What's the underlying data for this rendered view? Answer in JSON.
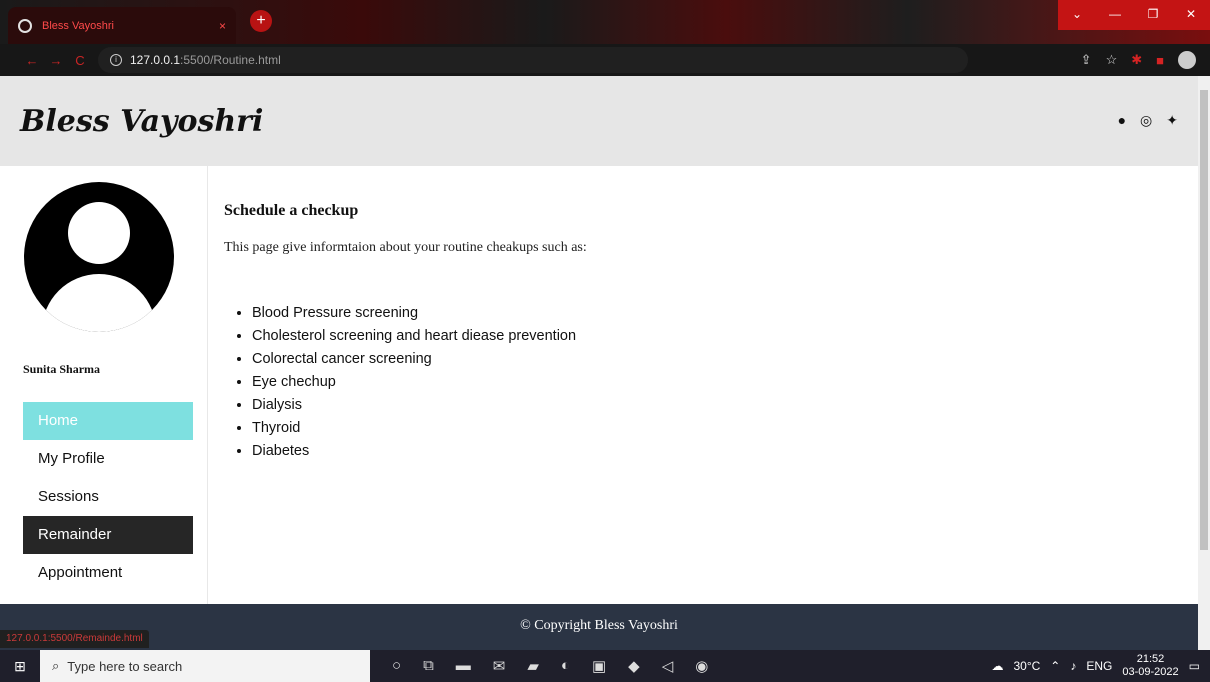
{
  "browser": {
    "tab_title": "Bless Vayoshri",
    "tab_close": "×",
    "new_tab": "+",
    "url_host": "127.0.0.1",
    "url_path": ":5500/Routine.html",
    "status_url": "127.0.0.1:5500/Remainde.html"
  },
  "header": {
    "brand": "Bless Vayoshri",
    "socials": [
      "facebook-icon",
      "instagram-icon",
      "twitter-icon"
    ]
  },
  "sidebar": {
    "user_name": "Sunita Sharma",
    "items": [
      {
        "label": "Home"
      },
      {
        "label": "My Profile"
      },
      {
        "label": "Sessions"
      },
      {
        "label": "Remainder"
      },
      {
        "label": "Appointment"
      }
    ]
  },
  "main": {
    "heading": "Schedule a checkup",
    "intro": "This page give informtaion about your routine cheakups such as:",
    "checkups": [
      "Blood Pressure screening",
      "Cholesterol screening and heart diease prevention",
      "Colorectal cancer screening",
      "Eye chechup",
      "Dialysis",
      "Thyroid",
      "Diabetes"
    ]
  },
  "footer": {
    "copyright": "© Copyright Bless Vayoshri"
  },
  "taskbar": {
    "search_placeholder": "Type here to search",
    "weather": "30°C",
    "language": "ENG",
    "time": "21:52",
    "date": "03-09-2022"
  },
  "colors": {
    "active_menu": "#7ee0e0",
    "dark_menu": "#262626",
    "footer": "#2b3444",
    "header": "#e6e6e6"
  }
}
